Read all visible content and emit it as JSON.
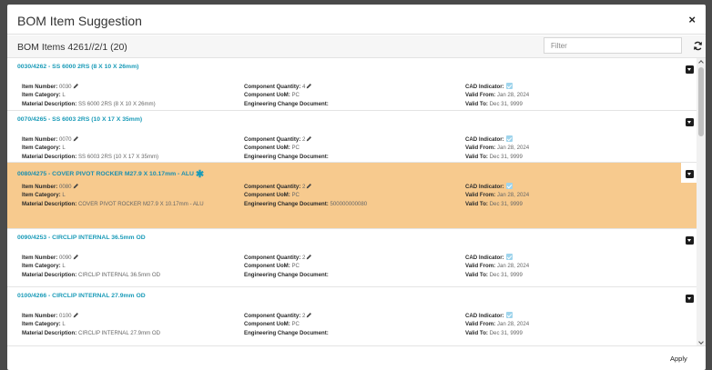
{
  "dialog": {
    "title": "BOM Item Suggestion",
    "close_label": "×",
    "subtitle": "BOM Items 4261//2/1 (20)",
    "filter_placeholder": "Filter",
    "apply_label": "Apply"
  },
  "labels": {
    "item_number": "Item Number:",
    "item_category": "Item Category:",
    "material_description": "Material Description:",
    "component_quantity": "Component Quantity:",
    "component_uom": "Component UoM:",
    "engineering_change_document": "Engineering Change Document:",
    "cad_indicator": "CAD Indicator:",
    "valid_from": "Valid From:",
    "valid_to": "Valid To:"
  },
  "items": [
    {
      "header": "0030/4262 - SS 6000 2RS (8 X 10 X 26mm)",
      "item_number": "0030",
      "item_category": "L",
      "material_description": "SS 6000 2RS (8 X 10 X 26mm)",
      "component_quantity": "4",
      "component_uom": "PC",
      "engineering_change_document": "",
      "valid_from": "Jan 28, 2024",
      "valid_to": "Dec 31, 9999"
    },
    {
      "header": "0070/4265 - SS 6003 2RS (10 X 17 X 35mm)",
      "item_number": "0070",
      "item_category": "L",
      "material_description": "SS 6003 2RS (10 X 17 X 35mm)",
      "component_quantity": "2",
      "component_uom": "PC",
      "engineering_change_document": "",
      "valid_from": "Jan 28, 2024",
      "valid_to": "Dec 31, 9999"
    },
    {
      "header": "0080/4275 - COVER PIVOT ROCKER M27.9 X 10.17mm - ALU",
      "item_number": "0080",
      "item_category": "L",
      "material_description": "COVER PIVOT ROCKER M27.9 X 10.17mm - ALU",
      "component_quantity": "2",
      "component_uom": "PC",
      "engineering_change_document": "500000000080",
      "valid_from": "Jan 28, 2024",
      "valid_to": "Dec 31, 9999"
    },
    {
      "header": "0090/4253 - CIRCLIP INTERNAL 36.5mm OD",
      "item_number": "0090",
      "item_category": "L",
      "material_description": "CIRCLIP INTERNAL 36.5mm OD",
      "component_quantity": "2",
      "component_uom": "PC",
      "engineering_change_document": "",
      "valid_from": "Jan 28, 2024",
      "valid_to": "Dec 31, 9999"
    },
    {
      "header": "0100/4266 - CIRCLIP INTERNAL 27.9mm OD",
      "item_number": "0100",
      "item_category": "L",
      "material_description": "CIRCLIP INTERNAL 27.9mm OD",
      "component_quantity": "2",
      "component_uom": "PC",
      "engineering_change_document": "",
      "valid_from": "Jan 28, 2024",
      "valid_to": "Dec 31, 9999"
    }
  ],
  "colors": {
    "accent": "#1a9bb8",
    "selected_row": "#f7ca8e",
    "cad_checkbox": "#9ed4ec"
  }
}
